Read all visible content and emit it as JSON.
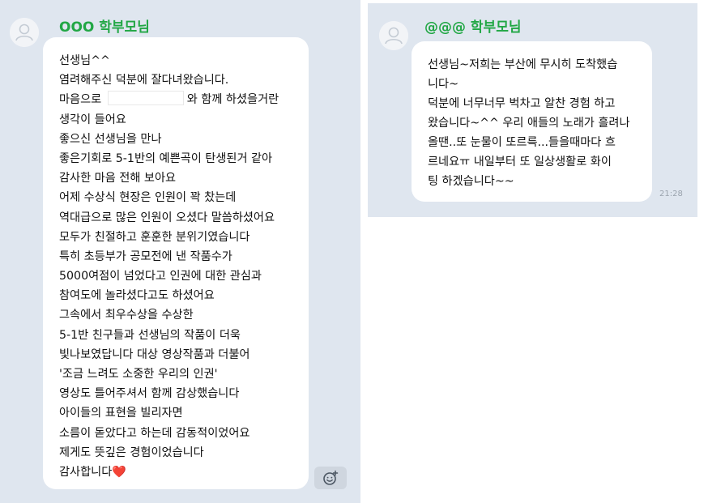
{
  "left_chat": {
    "sender": "OOO 학부모님",
    "lines": [
      "선생님^^",
      "염려해주신 덕분에 잘다녀왔습니다.",
      "마음으로 ",
      "생각이 들어요",
      "좋으신 선생님을 만나",
      "좋은기회로 5-1반의 예쁜곡이 탄생된거 같아",
      "감사한 마음 전해 보아요",
      "어제 수상식 현장은 인원이 꽉 찼는데",
      "역대급으로 많은 인원이 오셨다 말씀하셨어요",
      "모두가 친절하고 훈훈한 분위기였습니다",
      "특히 초등부가 공모전에 낸 작품수가",
      "5000여점이 넘었다고 인권에 대한 관심과",
      "참여도에 놀라셨다고도 하셨어요",
      "그속에서 최우수상을 수상한",
      "5-1반 친구들과 선생님의 작품이 더욱",
      "빛나보였답니다 대상 영상작품과 더불어",
      "'조금 느려도 소중한 우리의 인권'",
      "영상도 틀어주셔서 함께 감상했습니다",
      "아이들의 표현을 빌리자면",
      "소름이 돋았다고 하는데 감동적이었어요",
      "제게도 뜻깊은 경험이었습니다",
      "감사합니다❤️"
    ],
    "line3_suffix": "와 함께 하셨을거란"
  },
  "right_chat": {
    "sender": "@@@ 학부모님",
    "lines": [
      "선생님~저희는 부산에 무시히 도착했습",
      "니다~",
      "덕분에 너무너무 벅차고 알찬 경험 하고",
      "왔습니다~^^ 우리 애들의 노래가 흘려나",
      "올땐..또 눈물이 또르륵...들을때마다 흐",
      "르네요ㅠ 내일부터 또 일상생활로 화이",
      "팅 하겠습니다~~"
    ],
    "time": "21:28"
  },
  "icons": {
    "avatar": "default-profile-icon",
    "emoji": "smiley-plus-icon"
  },
  "colors": {
    "panel_bg": "#dfe6ef",
    "sender_name": "#22a745",
    "bubble": "#ffffff"
  }
}
